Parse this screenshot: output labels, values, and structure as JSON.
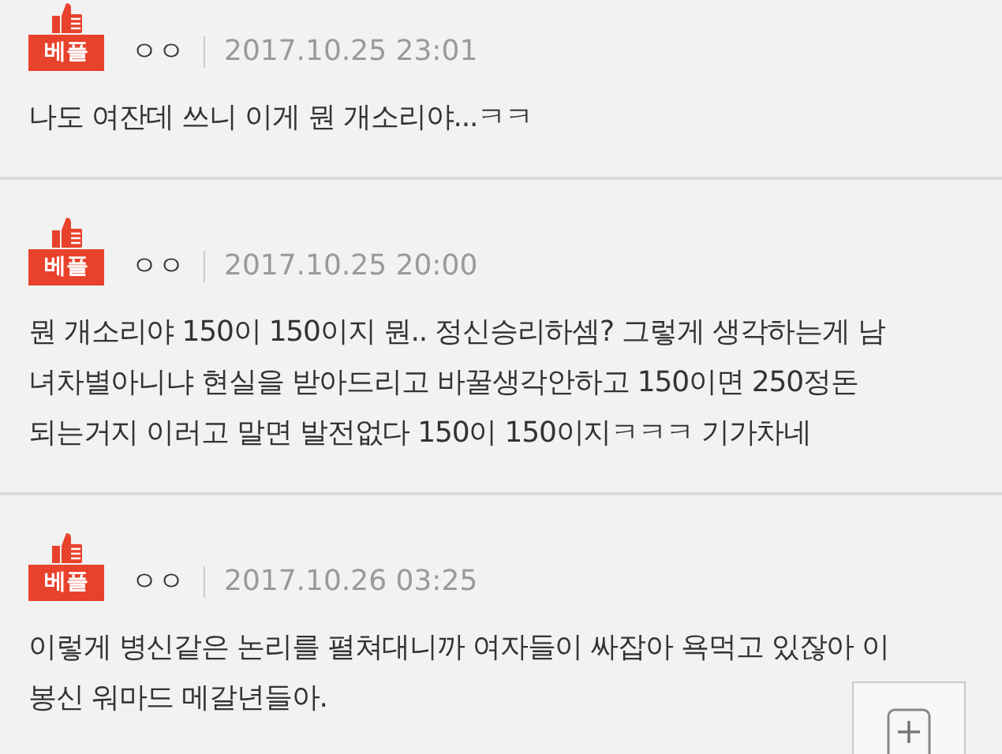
{
  "comments": [
    {
      "badge": "베플",
      "author": "ㅇㅇ",
      "date": "2017.10.25 23:01",
      "lines": [
        "나도 여잔데 쓰니 이게 뭔 개소리야...ㅋㅋ"
      ]
    },
    {
      "badge": "베플",
      "author": "ㅇㅇ",
      "date": "2017.10.25 20:00",
      "lines": [
        "뭔 개소리야 150이 150이지 뭔.. 정신승리하셈? 그렇게 생각하는게 남",
        "녀차별아니냐 현실을 받아드리고 바꿀생각안하고 150이면 250정돈",
        "되는거지 이러고 말면 발전없다 150이 150이지ㅋㅋㅋ 기가차네"
      ]
    },
    {
      "badge": "베플",
      "author": "ㅇㅇ",
      "date": "2017.10.26 03:25",
      "lines": [
        "이렇게 병신같은 논리를 펼쳐대니까 여자들이 싸잡아 욕먹고 있잖아 이",
        "봉신 워마드 메갈년들아."
      ]
    }
  ]
}
